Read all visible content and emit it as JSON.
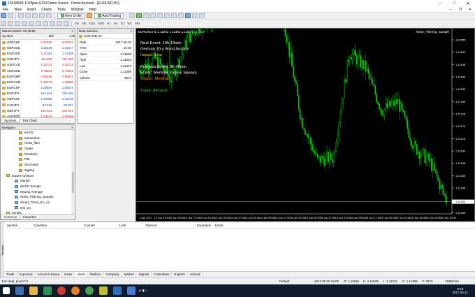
{
  "window": {
    "title": "12018608: FXOpen-ECN Demo Server - Demo Account - [EURUSD,H1]"
  },
  "menu": [
    "File",
    "View",
    "Insert",
    "Charts",
    "Tools",
    "Window",
    "Help"
  ],
  "toolbar": {
    "new_order": "New Order",
    "autotrading": "AutoTrading",
    "timeframes": [
      "M1",
      "M5",
      "M15",
      "M30",
      "H1",
      "H4",
      "D1",
      "W1",
      "MN"
    ]
  },
  "market_watch": {
    "title": "Market Watch: 01:49:58",
    "headers": [
      "Symbol",
      "Bid",
      "Ask"
    ],
    "rows": [
      {
        "symbol": "USDCHF",
        "bid": "0.97480",
        "ask": "0.97501",
        "bid_color": "red",
        "ask_color": "red"
      },
      {
        "symbol": "GBPUSD",
        "bid": "1.26238",
        "ask": "1.26247",
        "bid_color": "blue",
        "ask_color": "blue"
      },
      {
        "symbol": "EURUSD",
        "bid": "1.11351",
        "ask": "1.11355",
        "bid_color": "blue",
        "ask_color": "blue"
      },
      {
        "symbol": "USDJPY",
        "bid": "111.395",
        "ask": "111.400",
        "bid_color": "red",
        "ask_color": "red"
      },
      {
        "symbol": "USDCAD",
        "bid": "1.32712",
        "ask": "1.32722",
        "bid_color": "red",
        "ask_color": "red"
      },
      {
        "symbol": "AUDUSD",
        "bid": "0.75811",
        "ask": "0.75815",
        "bid_color": "red",
        "ask_color": "red"
      },
      {
        "symbol": "EURGBP",
        "bid": "0.88199",
        "ask": "0.88211",
        "bid_color": "red",
        "ask_color": "red"
      },
      {
        "symbol": "EURAUD",
        "bid": "1.46872",
        "ask": "1.46882",
        "bid_color": "red",
        "ask_color": "red"
      },
      {
        "symbol": "EURCHF",
        "bid": "1.08555",
        "ask": "1.08571",
        "bid_color": "blue",
        "ask_color": "blue"
      },
      {
        "symbol": "EURJPY",
        "bid": "124.044",
        "ask": "124.058",
        "bid_color": "blue",
        "ask_color": "blue"
      },
      {
        "symbol": "GBPCHF",
        "bid": "1.23088",
        "ask": "1.23108",
        "bid_color": "blue",
        "ask_color": "blue"
      },
      {
        "symbol": "CADJPY",
        "bid": "83.932",
        "ask": "83.947",
        "bid_color": "blue",
        "ask_color": "blue"
      },
      {
        "symbol": "GBPJPY",
        "bid": "140.624",
        "ask": "140.641",
        "bid_color": "red",
        "ask_color": "red"
      },
      {
        "symbol": "AUDNZD",
        "bid": "1.04442",
        "ask": "1.04459",
        "bid_color": "red",
        "ask_color": "red"
      }
    ],
    "tabs": [
      "Symbols",
      "Tick Chart"
    ]
  },
  "data_window": {
    "title": "Data Window",
    "symbol": "EURUSD,H1",
    "rows": [
      {
        "label": "Date",
        "value": "2017.06.20"
      },
      {
        "label": "Time",
        "value": "16:00"
      },
      {
        "label": "Open",
        "value": "1.11506"
      },
      {
        "label": "High",
        "value": "1.11533"
      },
      {
        "label": "Low",
        "value": "1.11342"
      },
      {
        "label": "Close",
        "value": "1.11369"
      },
      {
        "label": "Volume",
        "value": "3974"
      }
    ]
  },
  "navigator": {
    "title": "Navigator",
    "items": [
      {
        "label": "MACD",
        "type": "ind",
        "indent": 4
      },
      {
        "label": "Momentum",
        "type": "ind",
        "indent": 4
      },
      {
        "label": "News_filter",
        "type": "ind",
        "indent": 4
      },
      {
        "label": "OsMA",
        "type": "ind",
        "indent": 4
      },
      {
        "label": "Parabolic",
        "type": "ind",
        "indent": 4
      },
      {
        "label": "RSI",
        "type": "ind",
        "indent": 4
      },
      {
        "label": "Stochastic",
        "type": "ind",
        "indent": 4
      },
      {
        "label": "ZigZag",
        "type": "ind",
        "indent": 4
      },
      {
        "label": "Expert Advisors",
        "type": "folder",
        "indent": 1
      },
      {
        "label": "Market",
        "type": "ea",
        "indent": 3
      },
      {
        "label": "MACD Sample",
        "type": "ea",
        "indent": 3
      },
      {
        "label": "Moving Average",
        "type": "ea",
        "indent": 3
      },
      {
        "label": "News_Filtering_Sample",
        "type": "ea",
        "indent": 3
      },
      {
        "label": "Smart_Trend_EA_v3",
        "type": "ea",
        "indent": 3
      },
      {
        "label": "test_ea",
        "type": "ea",
        "indent": 3
      },
      {
        "label": "Scripts",
        "type": "folder",
        "indent": 1
      },
      {
        "label": "Examples",
        "type": "folder",
        "indent": 3
      }
    ],
    "tabs": [
      "Common",
      "Favorites"
    ]
  },
  "chart": {
    "tab_label": "EURUSD,H1  1.11342 1.11353 1.11333 1.11334",
    "ea_label": "News_Filtering_Sample",
    "overlay": [
      {
        "text": "Next Event: 10h 14min",
        "color": "#ffffff"
      },
      {
        "text": "German 30-y Bond Auction",
        "color": "#ffffff"
      },
      {
        "text": "Impact: Low",
        "color": "#ffd700"
      },
      {
        "text": "",
        "color": "#ffffff"
      },
      {
        "text": "Previous Event: 3h 49min",
        "color": "#ffffff"
      },
      {
        "text": "FOMC Member Kaplan Speaks",
        "color": "#ffffff"
      },
      {
        "text": "Impact: Medium",
        "color": "#ff8c00"
      },
      {
        "text": "",
        "color": "#ffffff"
      },
      {
        "text": "Trade: Allowed",
        "color": "#2ecc2e"
      }
    ],
    "price_labels": [
      "1.12055",
      "1.12000",
      "1.11945",
      "1.11890",
      "1.11835",
      "1.11780",
      "1.11725",
      "1.11670",
      "1.11615",
      "1.11560",
      "1.11505",
      "1.11450",
      "1.11395",
      "1.11340",
      "1.11285"
    ],
    "time_labels": [
      "1 Jun 2017",
      "12 Jun 01:00",
      "12 Jun 09:00",
      "12 Jun 17:00",
      "13 Jun 01:00",
      "13 Jun 09:00",
      "13 Jun 17:00",
      "14 Jun 01:00",
      "14 Jun 09:00",
      "14 Jun 17:00",
      "15 Jun 01:00",
      "15 Jun 09:00",
      "15 Jun 17:00",
      "16 Jun 01:00",
      "16 Jun 09:00",
      "16 Jun 17:00",
      "19 Jun 02:00",
      "19 Jun 10:00",
      "19 Jun 18:00",
      "20 Jun 02:00",
      "20 Jun 10:00"
    ],
    "current_price": "1.11334",
    "colors": {
      "bull": "#00c800",
      "bear": "#00c800",
      "bg": "#000000",
      "grid_text": "#ffffff"
    }
  },
  "chart_data": {
    "type": "line",
    "title": "EURUSD,H1",
    "xlabel": "",
    "ylabel": "",
    "ylim": [
      1.1128,
      1.1208
    ],
    "x": [
      "12 Jun 01:00",
      "12 Jun 09:00",
      "12 Jun 17:00",
      "13 Jun 01:00",
      "13 Jun 09:00",
      "13 Jun 17:00",
      "14 Jun 01:00",
      "14 Jun 09:00",
      "14 Jun 17:00",
      "15 Jun 01:00",
      "15 Jun 09:00",
      "15 Jun 17:00",
      "16 Jun 01:00",
      "16 Jun 09:00",
      "16 Jun 17:00",
      "19 Jun 02:00",
      "19 Jun 10:00",
      "19 Jun 18:00",
      "20 Jun 02:00",
      "20 Jun 10:00"
    ],
    "series": [
      {
        "values": [
          1.1192,
          1.1197,
          1.1188,
          1.1206,
          1.1213,
          1.1214,
          1.1229,
          1.1251,
          1.1251,
          1.1212,
          1.1171,
          1.1152,
          1.1153,
          1.12,
          1.1193,
          1.1174,
          1.1178,
          1.1158,
          1.1151,
          1.1134
        ]
      }
    ]
  },
  "terminal": {
    "columns": [
      "Symbol",
      "Condition",
      "Counter",
      "Limit",
      "Timeout",
      "Expiration",
      "Event"
    ],
    "side_label": "Terminal",
    "tabs": [
      "Trade",
      "Exposure",
      "Account History",
      "News",
      "Alerts",
      "Mailbox",
      "Company",
      "Market",
      "Signals",
      "Code Base",
      "Experts",
      "Journal"
    ],
    "active_tab": "Alerts"
  },
  "status": {
    "help": "For Help, press F1",
    "profile": "Default",
    "datetime": "2017.06.20 16:00",
    "open": "O: 1.11506",
    "high": "H: 1.11533",
    "low": "L: 1.11342",
    "close": "C: 1.11369",
    "volume": "V: 3974",
    "traffic": "1935/3 kb"
  },
  "taskbar": {
    "time": "0:49",
    "date": "2017.06.21"
  }
}
